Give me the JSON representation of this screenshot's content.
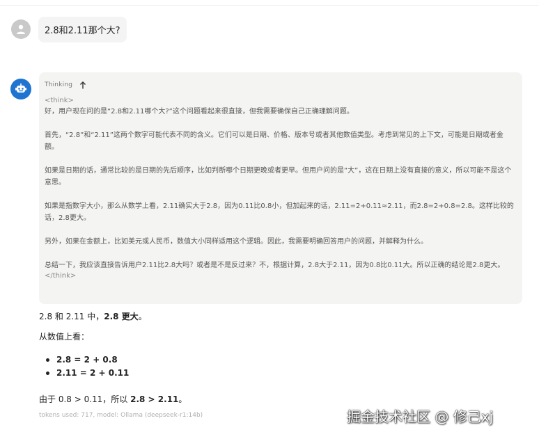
{
  "user_message": {
    "text": "2.8和2.11那个大?"
  },
  "thinking": {
    "label": "Thinking",
    "open_tag": "<think>",
    "close_tag": "</think>",
    "paragraphs": [
      "好，用户现在问的是“2.8和2.11哪个大?”这个问题看起来很直接，但我需要确保自己正确理解问题。",
      "首先，“2.8”和“2.11”这两个数字可能代表不同的含义。它们可以是日期、价格、版本号或者其他数值类型。考虑到常见的上下文，可能是日期或者金额。",
      "如果是日期的话，通常比较的是日期的先后顺序，比如判断哪个日期更晚或者更早。但用户问的是“大”，这在日期上没有直接的意义，所以可能不是这个意思。",
      "如果是指数字大小，那么从数学上看，2.11确实大于2.8，因为0.11比0.8小，但加起来的话，2.11=2+0.11≈2.11，而2.8=2+0.8=2.8。这样比较的话，2.8更大。",
      "另外，如果在金额上，比如美元或人民币，数值大小同样适用这个逻辑。因此，我需要明确回答用户的问题，并解释为什么。",
      "总结一下，我应该直接告诉用户2.11比2.8大吗？或者是不是反过来？不，根据计算，2.8大于2.11，因为0.8比0.11大。所以正确的结论是2.8更大。"
    ]
  },
  "answer": {
    "line1_prefix": "2.8 和 2.11 中，",
    "line1_bold": "2.8 更大",
    "line1_suffix": "。",
    "line2": "从数值上看：",
    "bullets": [
      "2.8 = 2 + 0.8",
      "2.11 = 2 + 0.11"
    ],
    "line3_prefix": "由于 0.8 > 0.11，所以 ",
    "line3_bold": "2.8 > 2.11",
    "line3_suffix": "。"
  },
  "meta": {
    "text": "tokens used: 717, model: Ollama (deepseek-r1:14b)"
  },
  "watermark": {
    "text": "掘金技术社区 @ 修己xj"
  },
  "colors": {
    "bot_avatar": "#1e74d0",
    "user_avatar": "#c9c9c9",
    "thinking_bg": "#f4f4f2"
  }
}
